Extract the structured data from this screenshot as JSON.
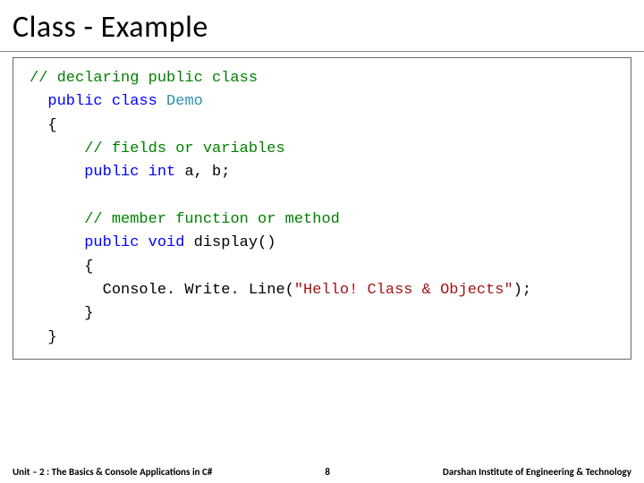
{
  "slide": {
    "title": "Class - Example"
  },
  "code": {
    "l1_comment": "// declaring public class",
    "l2_kw1": "public",
    "l2_kw2": "class",
    "l2_type": "Demo",
    "l3": "{",
    "l4_comment": "// fields or variables",
    "l5_kw1": "public",
    "l5_kw2": "int",
    "l5_rest": " a, b;",
    "l6_comment": "// member function or method",
    "l7_kw1": "public",
    "l7_kw2": "void",
    "l7_rest": " display()",
    "l8": "{",
    "l9_pre": "  Console. Write. Line(",
    "l9_str": "\"Hello! Class & Objects\"",
    "l9_post": ");",
    "l10": "}",
    "l11": "}"
  },
  "footer": {
    "left": "Unit – 2 : The Basics & Console Applications in C#",
    "page": "8",
    "right": "Darshan Institute of Engineering & Technology"
  }
}
